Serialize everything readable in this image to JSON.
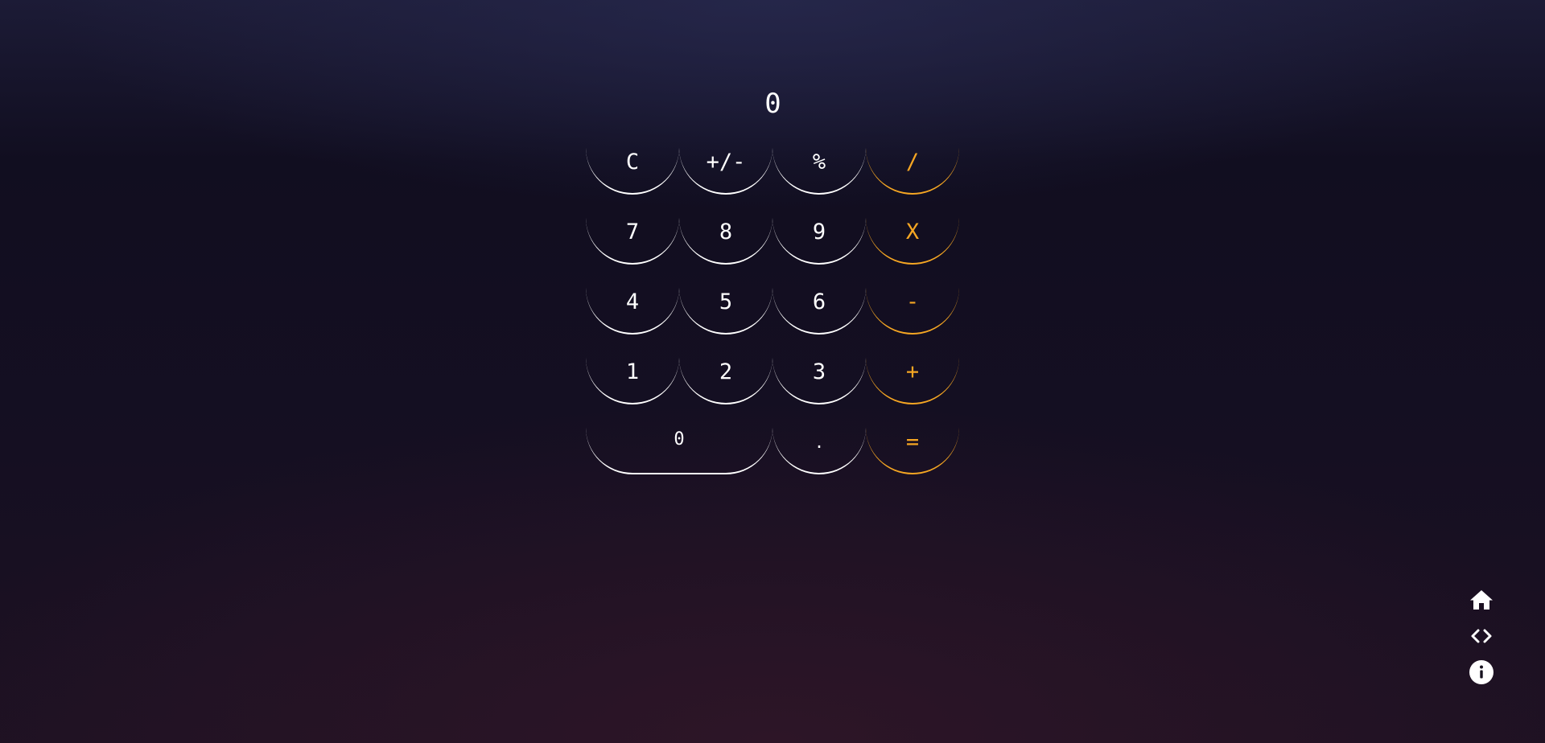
{
  "display": {
    "value": "0"
  },
  "keypad": {
    "rows": [
      [
        "C",
        "+/-",
        "%",
        "/"
      ],
      [
        "7",
        "8",
        "9",
        "X"
      ],
      [
        "4",
        "5",
        "6",
        "-"
      ],
      [
        "1",
        "2",
        "3",
        "+"
      ],
      [
        "0",
        ".",
        "="
      ]
    ]
  },
  "nav": {
    "icons": [
      "home-icon",
      "code-icon",
      "info-icon"
    ]
  },
  "colors": {
    "text": "#ffffff",
    "operator": "#f5a623",
    "background_top": "#1c1b36",
    "background_bottom": "#1d1122"
  }
}
